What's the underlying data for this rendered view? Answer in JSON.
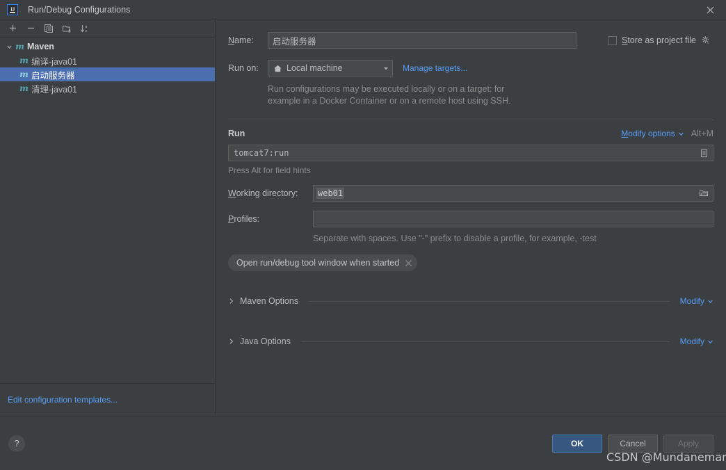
{
  "window": {
    "title": "Run/Debug Configurations",
    "logo_icon": "intellij-idea-logo",
    "close_icon": "close-icon"
  },
  "toolbar": {
    "buttons": [
      {
        "name": "add-configuration-button",
        "icon": "plus-icon"
      },
      {
        "name": "remove-configuration-button",
        "icon": "minus-icon"
      },
      {
        "name": "copy-configuration-button",
        "icon": "copy-icon"
      },
      {
        "name": "new-folder-button",
        "icon": "folder-add-icon"
      },
      {
        "name": "sort-configurations-button",
        "icon": "sort-alphabetical-icon"
      }
    ]
  },
  "sidebar": {
    "group": {
      "label": "Maven",
      "icon": "maven-icon",
      "expand_icon": "chevron-down-icon",
      "expanded": true
    },
    "items": [
      {
        "label": "编译-java01",
        "icon": "maven-icon",
        "selected": false
      },
      {
        "label": "启动服务器",
        "icon": "maven-icon",
        "selected": true
      },
      {
        "label": "清理-java01",
        "icon": "maven-icon",
        "selected": false
      }
    ],
    "footer_link": "Edit configuration templates..."
  },
  "form": {
    "name": {
      "label": "Name:",
      "label_mnemonic": "N",
      "value": "启动服务器"
    },
    "store_as_project_file": {
      "label": "Store as project file",
      "label_mnemonic": "S",
      "checked": false,
      "gear_icon": "gear-dropdown-icon"
    },
    "run_on": {
      "label": "Run on:",
      "value": "Local machine",
      "icon": "home-icon",
      "dropdown_icon": "triangle-down-icon",
      "manage_targets_link": "Manage targets..."
    },
    "target_hint_line1": "Run configurations may be executed locally or on a target: for",
    "target_hint_line2": "example in a Docker Container or on a remote host using SSH.",
    "run_section": {
      "title": "Run",
      "modify_options_link": "Modify options",
      "modify_options_chevron": "chevron-down-icon",
      "shortcut": "Alt+M",
      "command": "tomcat7:run",
      "expand_icon": "expand-editor-icon",
      "field_hint": "Press Alt for field hints"
    },
    "working_directory": {
      "label": "Working directory:",
      "label_mnemonic": "W",
      "value": "web01",
      "browse_icon": "folder-browse-icon"
    },
    "profiles": {
      "label": "Profiles:",
      "label_mnemonic": "P",
      "value": "",
      "hint": "Separate with spaces. Use \"-\" prefix to disable a profile, for example, -test"
    },
    "chip": {
      "label": "Open run/debug tool window when started",
      "close_icon": "chip-close-icon"
    },
    "sections": [
      {
        "label": "Maven Options",
        "expand_icon": "chevron-right-icon",
        "modify_link": "Modify",
        "modify_chevron": "chevron-down-icon"
      },
      {
        "label": "Java Options",
        "expand_icon": "chevron-right-icon",
        "modify_link": "Modify",
        "modify_chevron": "chevron-down-icon"
      }
    ]
  },
  "footer": {
    "help_icon": "?",
    "buttons": [
      {
        "name": "ok-button",
        "label": "OK",
        "style": "primary"
      },
      {
        "name": "cancel-button",
        "label": "Cancel",
        "style": "secondary"
      },
      {
        "name": "apply-button",
        "label": "Apply",
        "style": "disabled"
      }
    ]
  },
  "watermark": {
    "text": "CSDN @Mundaneman"
  },
  "colors": {
    "background": "#3c3f41",
    "field_background": "#45494a",
    "selection": "#4b6eaf",
    "link": "#589df6",
    "primary_button": "#365880",
    "maven_icon": "#57a6b5"
  }
}
